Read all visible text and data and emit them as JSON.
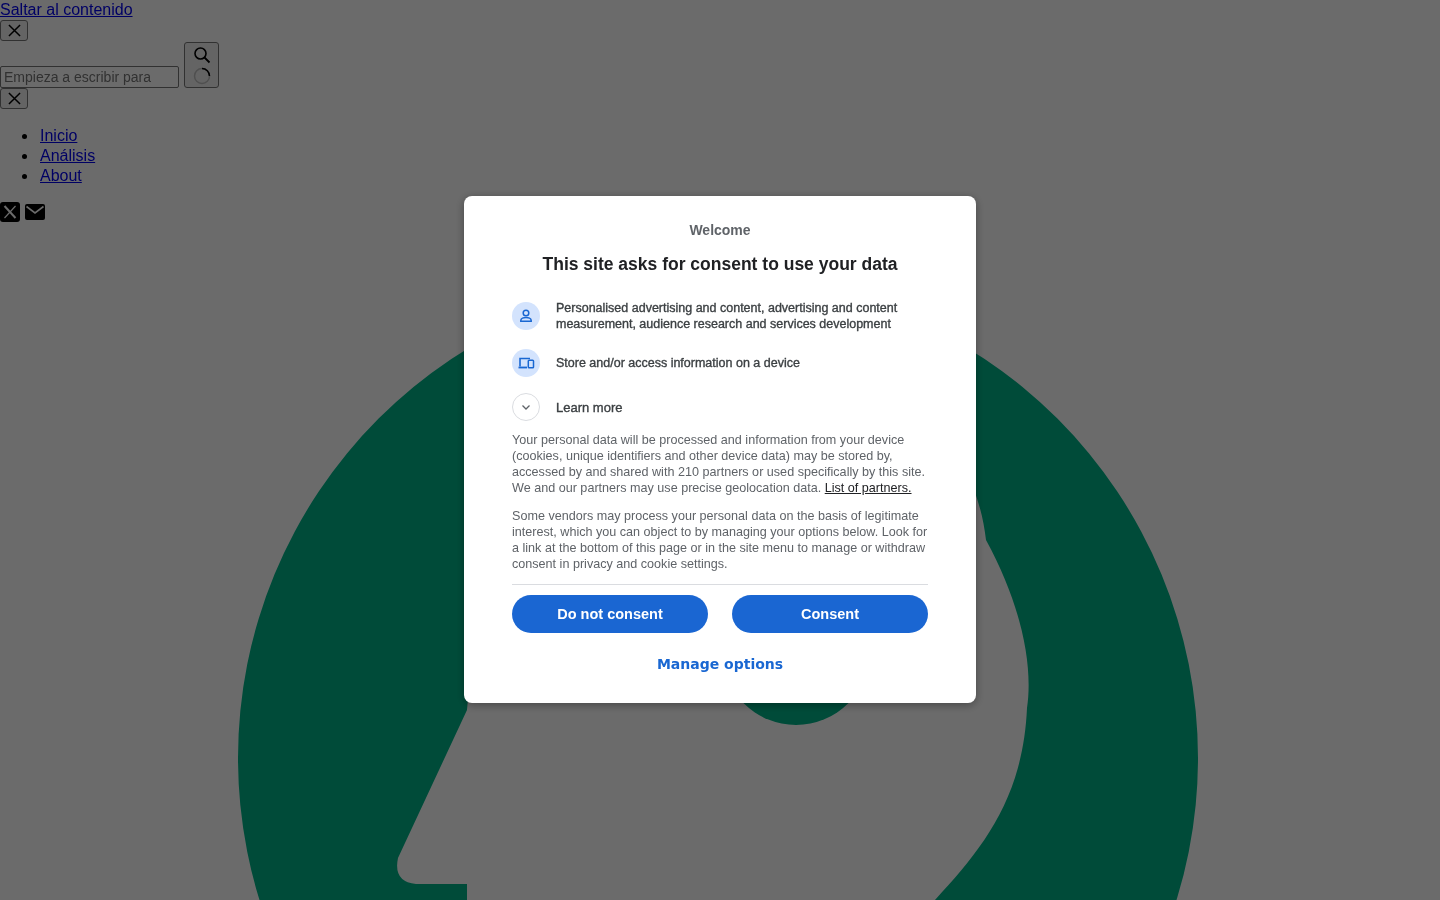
{
  "page": {
    "skip_link": "Saltar al contenido",
    "search": {
      "placeholder": "Empieza a escribir para"
    },
    "nav": [
      {
        "label": "Inicio"
      },
      {
        "label": "Análisis"
      },
      {
        "label": "About"
      }
    ]
  },
  "consent_dialog": {
    "eyebrow": "Welcome",
    "title": "This site asks for consent to use your data",
    "purposes": [
      {
        "label": "Personalised advertising and content, advertising and content measurement, audience research and services development"
      },
      {
        "label": "Store and/or access information on a device"
      }
    ],
    "learn_more": {
      "label": "Learn more",
      "expanded": false
    },
    "paragraphs": [
      {
        "text": "Your personal data will be processed and information from your device (cookies, unique identifiers and other device data) may be stored by, accessed by and shared with 210 partners or used specifically by this site. We and our partners may use precise geolocation data.",
        "link": "List of partners."
      },
      {
        "text": "Some vendors may process your personal data on the basis of legitimate interest, which you can object to by managing your options below. Look for a link at the bottom of this page or in the site menu to manage or withdraw consent in privacy and cookie settings."
      }
    ],
    "actions": [
      {
        "label": "Do not consent",
        "kind": "filled"
      },
      {
        "label": "Consent",
        "kind": "filled"
      },
      {
        "label": "Manage options",
        "kind": "text"
      }
    ]
  }
}
